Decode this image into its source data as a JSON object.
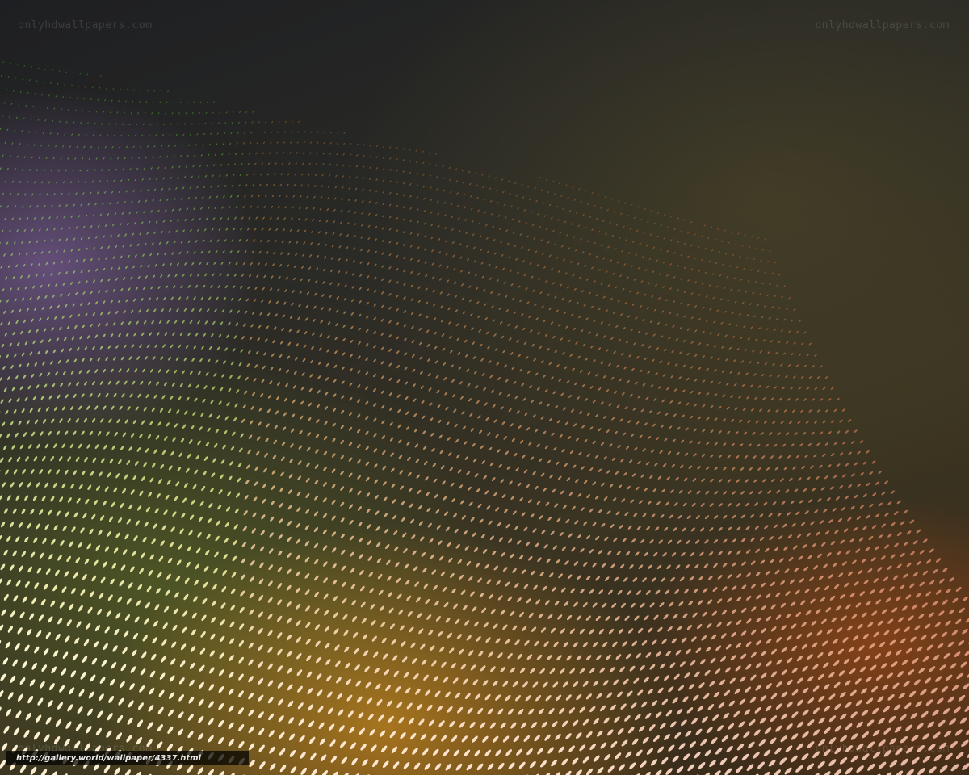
{
  "watermarks": {
    "top_left": "onlyhdwallpapers.com",
    "top_right": "onlyhdwallpapers.com",
    "bottom_left": "onlyhdwallpapers.com",
    "bottom_right": "onlyhdwallpapers.com"
  },
  "source_url": "http://gallery.world/wallpaper/4337.html",
  "colors": {
    "background_dark": "#1e1f22",
    "glow_orange": "#ffaa1e",
    "glow_purple": "#9670be",
    "glow_green": "#789628",
    "dot_light": "#fff6c0"
  }
}
